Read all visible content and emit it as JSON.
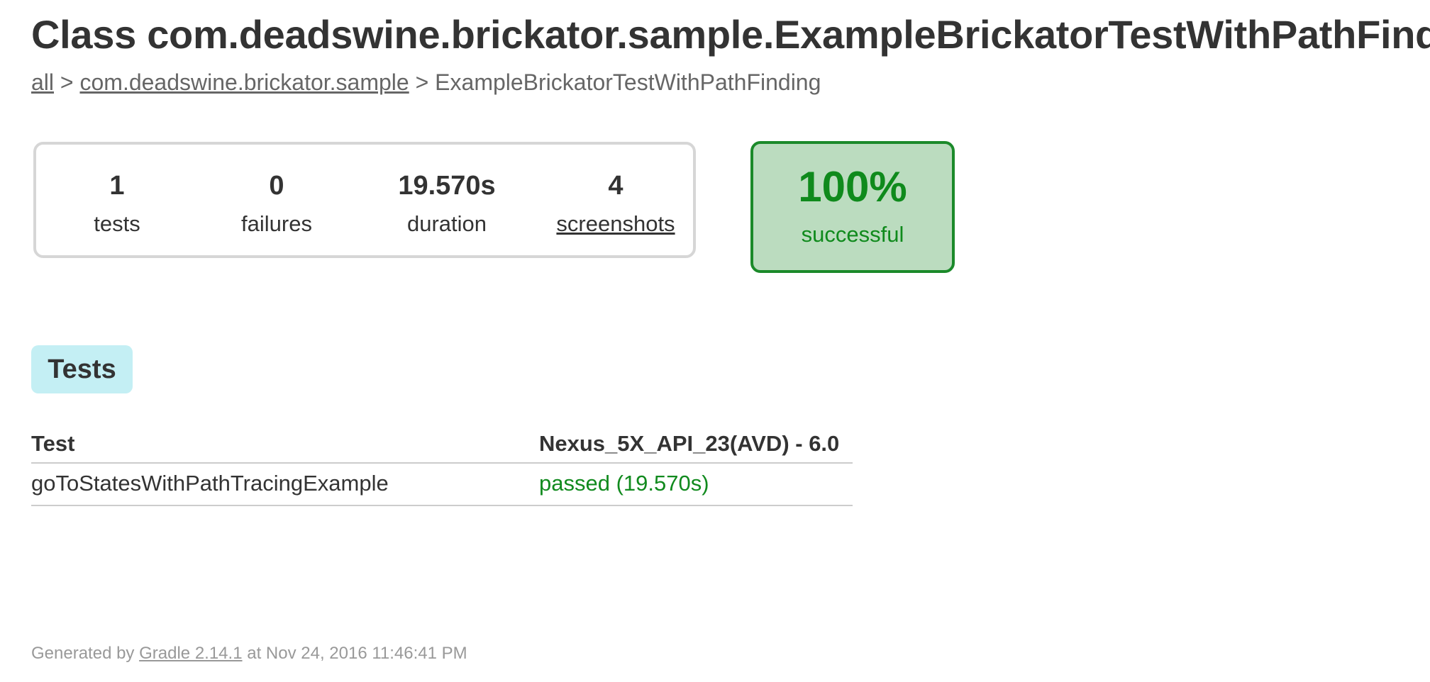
{
  "title": "Class com.deadswine.brickator.sample.ExampleBrickatorTestWithPathFinding",
  "breadcrumb": {
    "all": "all",
    "sep1": " > ",
    "package": "com.deadswine.brickator.sample",
    "sep2": " > ",
    "current": "ExampleBrickatorTestWithPathFinding"
  },
  "summary": {
    "tests": {
      "value": "1",
      "label": "tests"
    },
    "failures": {
      "value": "0",
      "label": "failures"
    },
    "duration": {
      "value": "19.570s",
      "label": "duration"
    },
    "screenshots": {
      "value": "4",
      "label": "screenshots"
    }
  },
  "success": {
    "value": "100%",
    "label": "successful"
  },
  "tabs": {
    "tests_label": "Tests"
  },
  "table": {
    "headers": [
      "Test",
      "Nexus_5X_API_23(AVD) - 6.0"
    ],
    "rows": [
      {
        "test": "goToStatesWithPathTracingExample",
        "result": "passed (19.570s)"
      }
    ]
  },
  "footer": {
    "prefix": "Generated by ",
    "link": "Gradle 2.14.1",
    "suffix": " at Nov 24, 2016 11:46:41 PM"
  },
  "colors": {
    "success_green": "#118a1e",
    "success_bg": "#bbdcbf",
    "tab_bg": "#c4eff4",
    "border_gray": "#d6d6d6"
  }
}
